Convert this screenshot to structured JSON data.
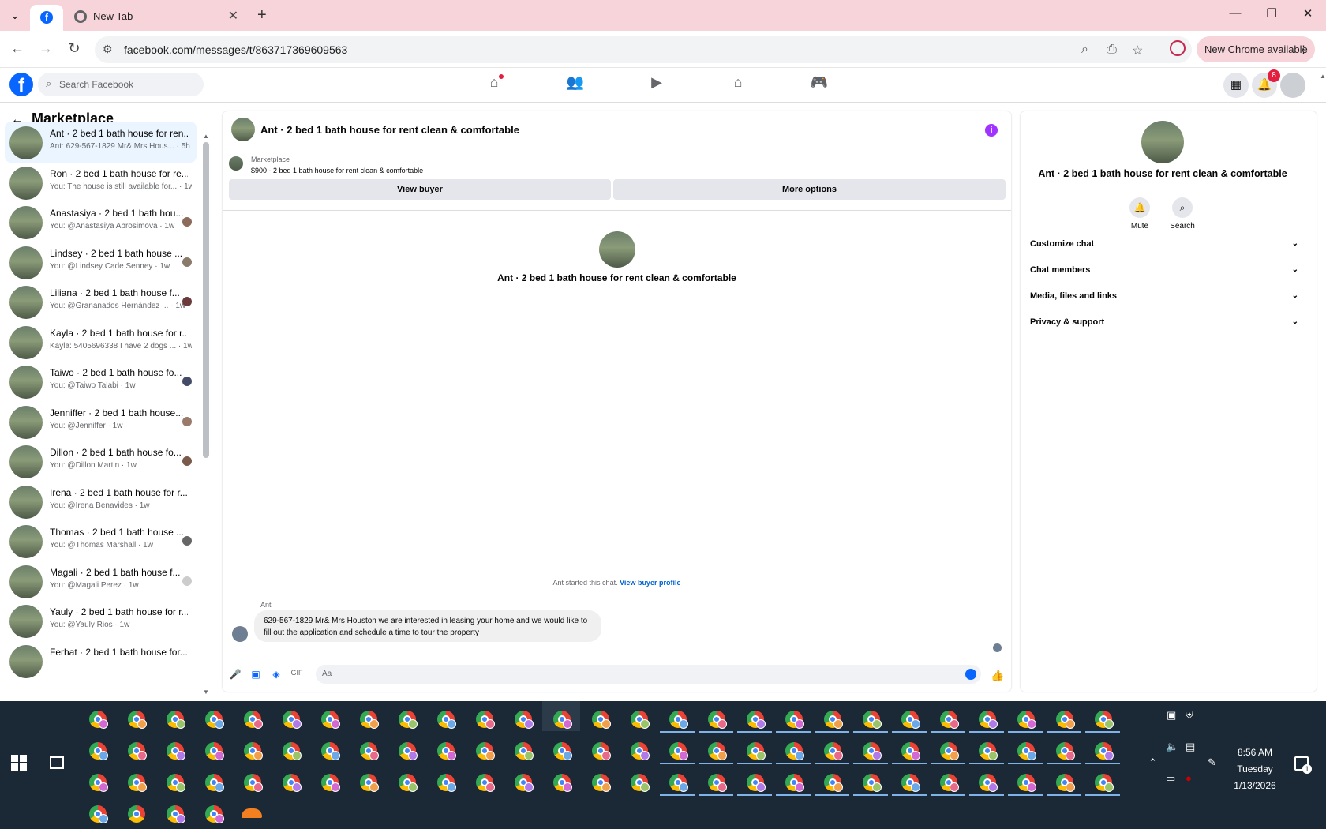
{
  "browser": {
    "tab_active_title": "Facebook",
    "tab_new_label": "New Tab",
    "url": "facebook.com/messages/t/863717369609563",
    "update_label": "New Chrome available"
  },
  "fb_header": {
    "search_placeholder": "Search Facebook",
    "notification_count": "8"
  },
  "sidebar": {
    "title": "Marketplace",
    "conversations": [
      {
        "name": "Ant · 2 bed 1 bath house for ren...",
        "snippet": "Ant: 629-567-1829 Mr& Mrs Hous... · 5h"
      },
      {
        "name": "Ron · 2 bed 1 bath house for re...",
        "snippet": "You: The house is still available for... · 1w"
      },
      {
        "name": "Anastasiya · 2 bed 1 bath hou...",
        "snippet": "You: @Anastasiya Abrosimova · 1w"
      },
      {
        "name": "Lindsey · 2 bed 1 bath house ...",
        "snippet": "You: @Lindsey Cade Senney · 1w"
      },
      {
        "name": "Liliana · 2 bed 1 bath house f...",
        "snippet": "You: @Grananados Hernández ... · 1w"
      },
      {
        "name": "Kayla · 2 bed 1 bath house for r...",
        "snippet": "Kayla: 5405696338 I have 2 dogs ... · 1w"
      },
      {
        "name": "Taiwo · 2 bed 1 bath house fo...",
        "snippet": "You: @Taiwo Talabi · 1w"
      },
      {
        "name": "Jenniffer · 2 bed 1 bath house...",
        "snippet": "You: @Jenniffer · 1w"
      },
      {
        "name": "Dillon · 2 bed 1 bath house fo...",
        "snippet": "You: @Dillon Martin · 1w"
      },
      {
        "name": "Irena · 2 bed 1 bath house for r...",
        "snippet": "You: @Irena Benavides · 1w"
      },
      {
        "name": "Thomas · 2 bed 1 bath house ...",
        "snippet": "You: @Thomas Marshall · 1w"
      },
      {
        "name": "Magali · 2 bed 1 bath house f...",
        "snippet": "You: @Magali Perez · 1w"
      },
      {
        "name": "Yauly · 2 bed 1 bath house for r...",
        "snippet": "You: @Yauly Rios · 1w"
      },
      {
        "name": "Ferhat · 2 bed 1 bath house for...",
        "snippet": ""
      }
    ]
  },
  "chat": {
    "title": "Ant · 2 bed 1 bath house for rent clean & comfortable",
    "marketplace_label": "Marketplace",
    "listing": "$900 - 2 bed 1 bath house for rent clean & comfortable",
    "view_buyer": "View buyer",
    "more_options": "More options",
    "started_text": "Ant started this chat.",
    "view_buyer_profile": "View buyer profile",
    "sender": "Ant",
    "message": "629-567-1829 Mr& Mrs Houston we are interested in leasing your home and we would like to fill out the application and schedule a time to tour the property",
    "composer_placeholder": "Aa"
  },
  "info_panel": {
    "title": "Ant · 2 bed 1 bath house for rent clean & comfortable",
    "mute": "Mute",
    "search": "Search",
    "sections": [
      "Customize chat",
      "Chat members",
      "Media, files and links",
      "Privacy & support"
    ]
  },
  "taskbar": {
    "time": "8:56 AM",
    "day": "Tuesday",
    "date": "1/13/2026",
    "notification_count": "1"
  }
}
